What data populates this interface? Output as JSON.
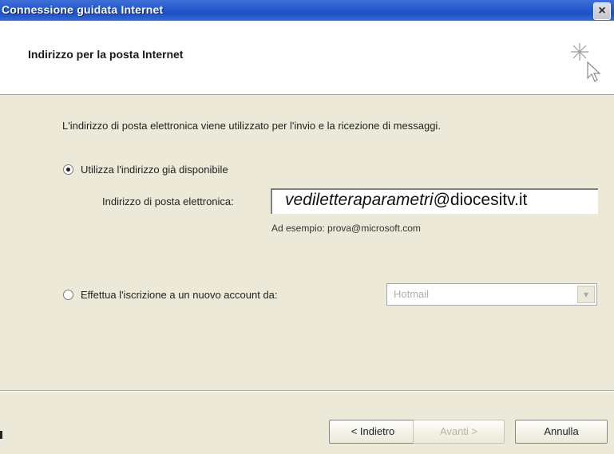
{
  "window": {
    "title": "Connessione guidata Internet",
    "close_glyph": "×"
  },
  "header": {
    "title": "Indirizzo per la posta Internet",
    "icon": "wizard-sparkle-cursor-icon"
  },
  "content": {
    "intro": "L'indirizzo di posta elettronica viene utilizzato per l'invio e la ricezione di messaggi.",
    "option_existing": {
      "label": "Utilizza l'indirizzo già disponibile",
      "selected": true
    },
    "email_label": "Indirizzo di posta elettronica:",
    "email_value_italic": "vediletteraparametri",
    "email_value_rest": "@diocesitv.it",
    "example": "Ad esempio: prova@microsoft.com",
    "option_new": {
      "label": "Effettua l'iscrizione a un nuovo account da:",
      "selected": false
    },
    "provider_select": {
      "value": "Hotmail",
      "arrow": "▾"
    }
  },
  "buttons": {
    "back": "< Indietro",
    "next": "Avanti >",
    "cancel": "Annulla"
  }
}
